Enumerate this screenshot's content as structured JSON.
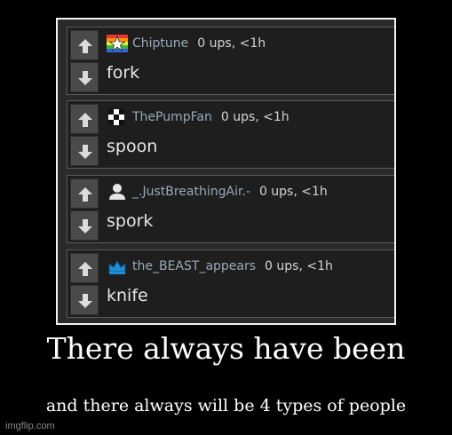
{
  "comments": [
    {
      "author": "Chiptune",
      "meta": "0 ups, <1h",
      "text": "fork",
      "icon": "rainbow-star-icon"
    },
    {
      "author": "ThePumpFan",
      "meta": "0 ups, <1h",
      "text": "spoon",
      "icon": "checkered-flag-icon"
    },
    {
      "author": "_.JustBreathingAir.-",
      "meta": "0 ups, <1h",
      "text": "spork",
      "icon": "user-silhouette-icon"
    },
    {
      "author": "the_BEAST_appears",
      "meta": "0 ups, <1h",
      "text": "knife",
      "icon": "blue-crown-icon"
    }
  ],
  "caption": {
    "main": "There always have been",
    "sub": "and there always will be 4 types of people"
  },
  "watermark": "imgflip.com",
  "colors": {
    "background": "#000000",
    "panel": "#1e1e1e",
    "author": "#9aa9b8",
    "vote_button": "#4a4a4a"
  }
}
